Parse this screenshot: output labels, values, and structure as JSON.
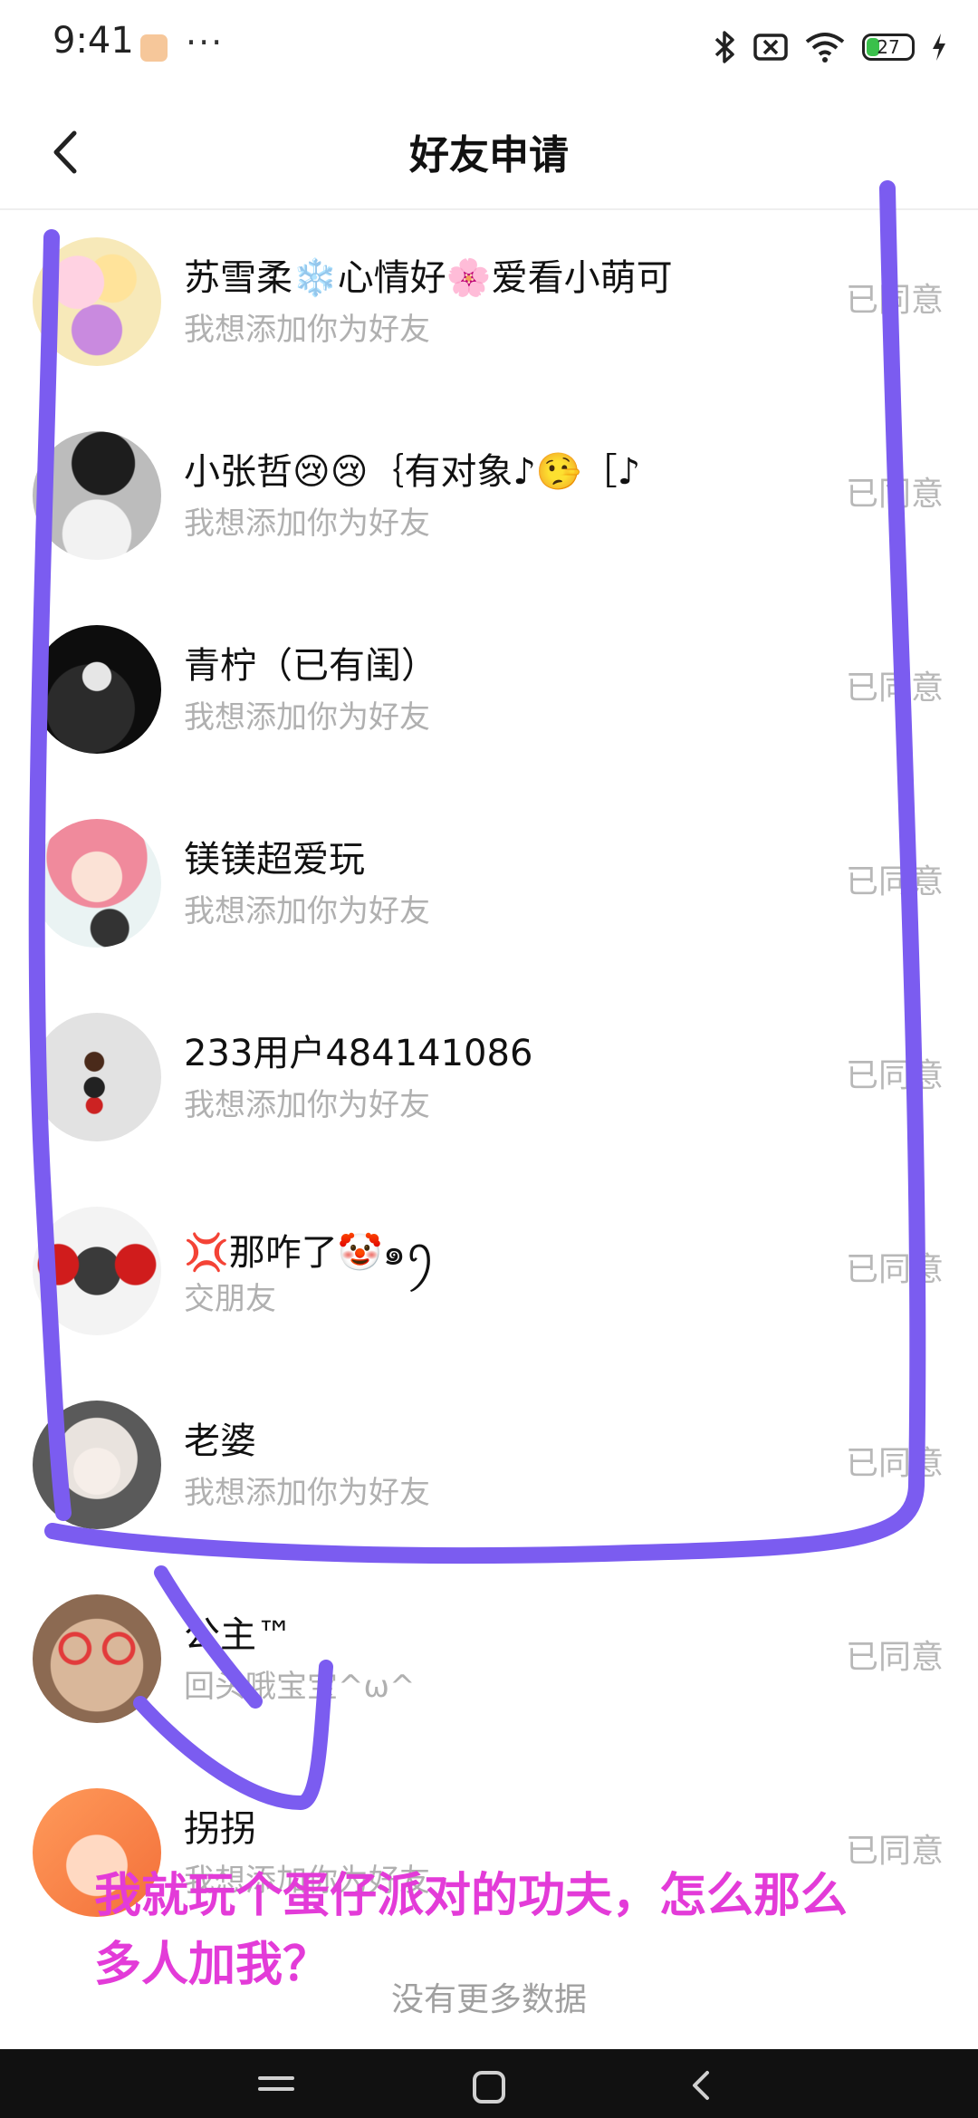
{
  "status_bar": {
    "time": "9:41",
    "more": "···",
    "battery": "27"
  },
  "header": {
    "title": "好友申请"
  },
  "requests": [
    {
      "name": "苏雪柔❄️心情好🌸爱看小萌可",
      "message": "我想添加你为好友",
      "status": "已同意"
    },
    {
      "name": "小张哲😢😢｛有对象♪🤥［♪",
      "message": "我想添加你为好友",
      "status": "已同意"
    },
    {
      "name": "青柠（已有闺）",
      "message": "我想添加你为好友",
      "status": "已同意"
    },
    {
      "name": "镁镁超爱玩",
      "message": "我想添加你为好友",
      "status": "已同意"
    },
    {
      "name": "233用户484141086",
      "message": "我想添加你为好友",
      "status": "已同意"
    },
    {
      "name": "💢那咋了🤡๑ꪆ",
      "message": "交朋友",
      "status": "已同意"
    },
    {
      "name": "老婆",
      "message": "我想添加你为好友",
      "status": "已同意"
    },
    {
      "name": "公主™",
      "message": "回头哦宝宝^ω^",
      "status": "已同意"
    },
    {
      "name": "拐拐",
      "message": "我想添加你为好友",
      "status": "已同意"
    }
  ],
  "footer": {
    "no_more": "没有更多数据"
  },
  "overlay": {
    "text": "我就玩个蛋仔派对的功夫，怎么那么多人加我？"
  },
  "colors": {
    "annotation_stroke": "#7b5cf0",
    "overlay_text": "#e33bd8",
    "status_text": "#b8b8b8"
  }
}
